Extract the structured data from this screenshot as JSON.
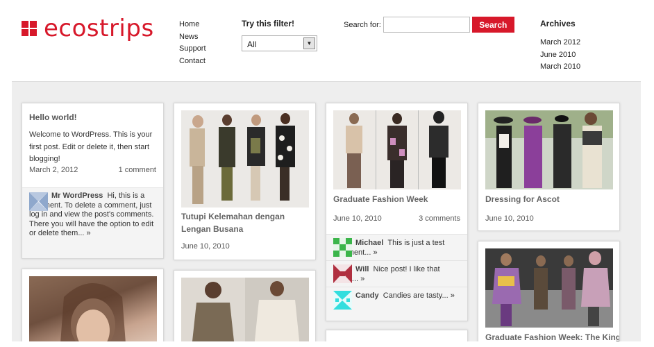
{
  "logo": {
    "text": "ecostrips"
  },
  "nav": [
    "Home",
    "News",
    "Support",
    "Contact"
  ],
  "filter": {
    "title": "Try this filter!",
    "selected": "All"
  },
  "search": {
    "label": "Search for:",
    "button": "Search",
    "value": ""
  },
  "archives": {
    "title": "Archives",
    "items": [
      "March 2012",
      "June 2010",
      "March 2010"
    ]
  },
  "posts": {
    "hello": {
      "title": "Hello world!",
      "excerpt": "Welcome to WordPress. This is your first post. Edit or delete it, then start blogging!",
      "date": "March 2, 2012",
      "comments": "1 comment",
      "comment": {
        "author": "Mr WordPress",
        "text": "Hi, this is a comment. To delete a comment, just log in and view the post's comments. There you will have the option to edit or delete them... »"
      }
    },
    "tutupi": {
      "title": "Tutupi Kelemahan dengan Lengan Busana",
      "date": "June 10, 2010"
    },
    "graduate": {
      "title": "Graduate Fashion Week",
      "date": "June 10, 2010",
      "comments": "3 comments",
      "replies": [
        {
          "author": "Michael",
          "text": "This is just a test comment... »"
        },
        {
          "author": "Will",
          "text": "Nice post! I like that dress... »"
        },
        {
          "author": "Candy",
          "text": "Candies are tasty... »"
        }
      ]
    },
    "ascot": {
      "title": "Dressing for Ascot",
      "date": "June 10, 2010"
    },
    "graduate_king": {
      "title": "Graduate Fashion Week: The King"
    }
  },
  "colors": {
    "brand": "#d7182a",
    "avatar_michael": "#3bb54a",
    "avatar_will": "#b03040",
    "avatar_candy": "#33dede",
    "avatar_mr": "#8fa8cc"
  }
}
